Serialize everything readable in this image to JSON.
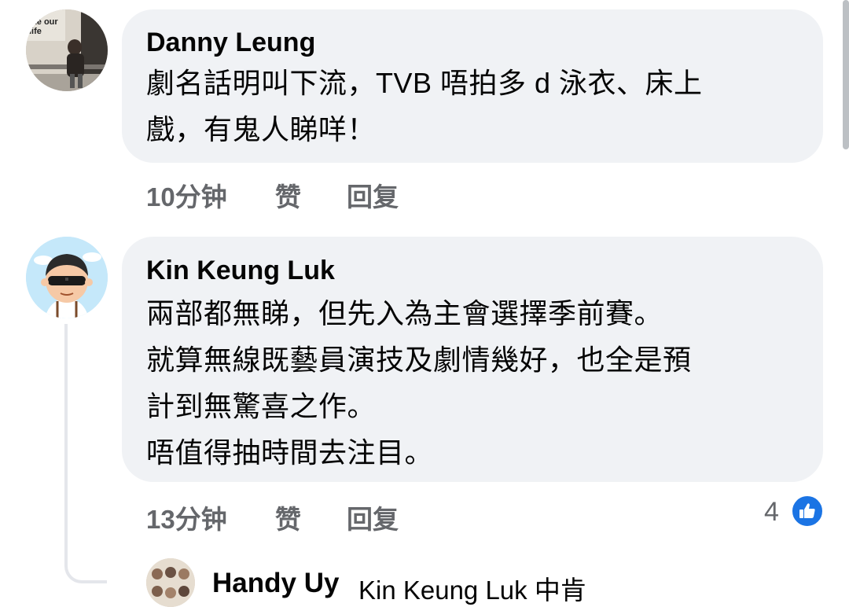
{
  "comments": [
    {
      "author": "Danny Leung",
      "avatar_text": "ste our life",
      "lines": [
        "劇名話明叫下流，TVB 唔拍多 d 泳衣、床上",
        "戲，有鬼人睇咩！"
      ],
      "time": "10分钟",
      "like_label": "赞",
      "reply_label": "回复"
    },
    {
      "author": "Kin Keung Luk",
      "lines": [
        "兩部都無睇，但先入為主會選擇季前賽。",
        "就算無線既藝員演技及劇情幾好，也全是預",
        "計到無驚喜之作。",
        "唔值得抽時間去注目。"
      ],
      "time": "13分钟",
      "like_label": "赞",
      "reply_label": "回复",
      "reaction_count": "4",
      "reaction_icon": "like-thumb-icon"
    }
  ],
  "reply": {
    "author": "Handy Uy",
    "mention_text": "Kin Keung Luk 中肯"
  },
  "colors": {
    "bubble": "#f0f2f5",
    "meta_text": "#65676b",
    "like_blue": "#1b74e4"
  }
}
